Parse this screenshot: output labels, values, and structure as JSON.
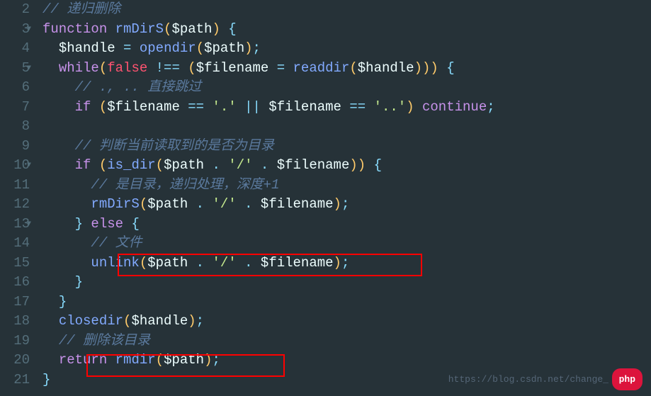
{
  "gutter": {
    "lines": [
      "2",
      "3",
      "4",
      "5",
      "6",
      "7",
      "8",
      "9",
      "10",
      "11",
      "12",
      "13",
      "14",
      "15",
      "16",
      "17",
      "18",
      "19",
      "20",
      "21"
    ],
    "fold_lines": [
      3,
      5,
      10,
      13
    ]
  },
  "tokens": {
    "comment_recursive_delete": "// 递归删除",
    "kw_function": "function",
    "fn_rmDirS": "rmDirS",
    "var_path": "$path",
    "var_handle": "$handle",
    "var_filename": "$filename",
    "fn_opendir": "opendir",
    "fn_readdir": "readdir",
    "fn_is_dir": "is_dir",
    "fn_unlink": "unlink",
    "fn_closedir": "closedir",
    "fn_rmdir": "rmdir",
    "kw_while": "while",
    "kw_if": "if",
    "kw_else": "else",
    "kw_continue": "continue",
    "kw_return": "return",
    "const_false": "false",
    "op_ne": "!==",
    "op_eq": "==",
    "op_assign": "=",
    "op_or": "||",
    "op_dot": ".",
    "str_dot": "'.'",
    "str_dotdot": "'..'",
    "str_slash": "'/'",
    "comment_skip": "// ., .. 直接跳过",
    "comment_check_dir": "// 判断当前读取到的是否为目录",
    "comment_is_dir": "// 是目录，递归处理，深度+1",
    "comment_file": "// 文件",
    "comment_delete_dir": "// 删除该目录",
    "brace_open": "{",
    "brace_close": "}",
    "paren_open": "(",
    "paren_close": ")",
    "semi": ";"
  },
  "watermark": "https://blog.csdn.net/change_",
  "badge": "php",
  "chart_data": {
    "type": "code",
    "language": "php",
    "source": "// 递归删除\nfunction rmDirS($path) {\n  $handle = opendir($path);\n  while(false !== ($filename = readdir($handle))) {\n    // ., .. 直接跳过\n    if ($filename == '.' || $filename == '..') continue;\n\n    // 判断当前读取到的是否为目录\n    if (is_dir($path . '/' . $filename)) {\n      // 是目录，递归处理，深度+1\n      rmDirS($path . '/' . $filename);\n    } else {\n      // 文件\n      unlink($path . '/' . $filename);\n    }\n  }\n  closedir($handle);\n  // 删除该目录\n  return rmdir($path);\n}"
  }
}
